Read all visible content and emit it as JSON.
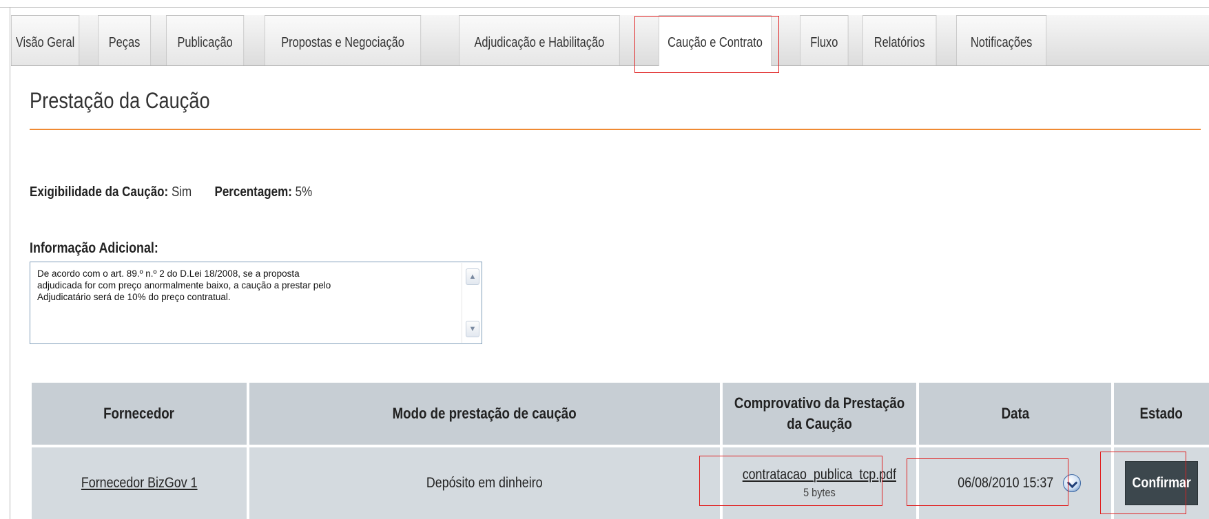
{
  "tabs": [
    {
      "label": "Visão Geral"
    },
    {
      "label": "Peças"
    },
    {
      "label": "Publicação"
    },
    {
      "label": "Propostas e Negociação"
    },
    {
      "label": "Adjudicação e Habilitação"
    },
    {
      "label": "Caução e Contrato",
      "active": true
    },
    {
      "label": "Fluxo"
    },
    {
      "label": "Relatórios"
    },
    {
      "label": "Notificações"
    }
  ],
  "section": {
    "title": "Prestação da Caução"
  },
  "exigibilidade": {
    "label": "Exigibilidade da Caução:",
    "value": "Sim"
  },
  "percentagem": {
    "label": "Percentagem:",
    "value": "5%"
  },
  "info": {
    "label": "Informação Adicional:",
    "lines": [
      "De acordo com o art. 89.º n.º 2 do D.Lei 18/2008, se a proposta",
      "adjudicada for com preço anormalmente baixo, a caução a prestar pelo",
      "Adjudicatário será de 10% do preço contratual."
    ]
  },
  "table": {
    "headers": {
      "fornecedor": "Fornecedor",
      "modo": "Modo de prestação de caução",
      "comprovativo_line1": "Comprovativo da Prestação",
      "comprovativo_line2": "da Caução",
      "data": "Data",
      "estado": "Estado"
    },
    "row": {
      "fornecedor": "Fornecedor BizGov 1",
      "modo": "Depósito em dinheiro",
      "file_name": "contratacao_publica_tcp.pdf",
      "file_size": "5 bytes",
      "data": "06/08/2010 15:37",
      "estado_button": "Confirmar"
    }
  },
  "colors": {
    "accent_rule": "#f08a32",
    "highlight_box": "#e02020",
    "header_cell": "#c7ced4",
    "body_cell": "#d4dadf",
    "confirm_button": "#3c474d"
  },
  "icons": {
    "scroll_up": "chevron-up-icon",
    "scroll_down": "chevron-down-icon",
    "date_picker": "clock-dropdown-icon"
  }
}
